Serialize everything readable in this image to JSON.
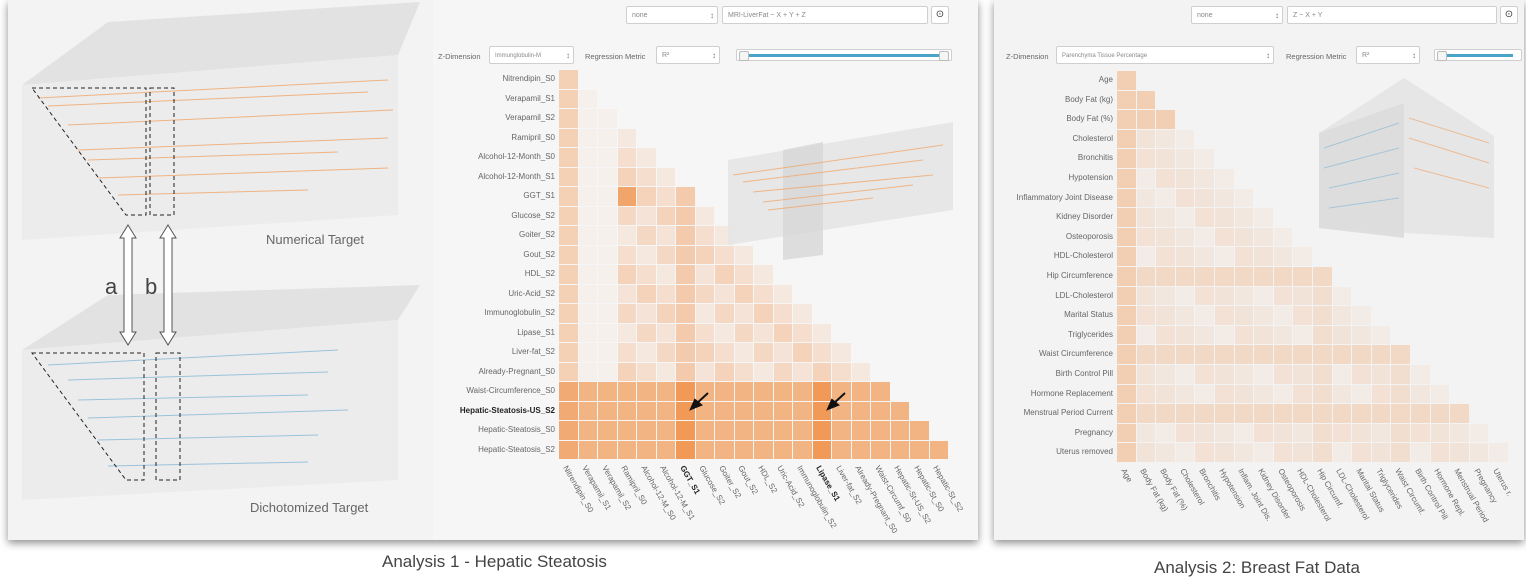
{
  "analysis1": {
    "caption": "Analysis 1 - Hepatic Steatosis",
    "left_labels": {
      "numerical": "Numerical Target",
      "dichotomized": "Dichotomized Target",
      "a": "a",
      "b": "b"
    },
    "top_controls": {
      "select_value": "none",
      "formula_value": "MRI-LiverFat ~ X + Y + Z",
      "target_icon": "target-icon"
    },
    "z_dimension": {
      "label": "Z-Dimension",
      "value": "Immunglobulin-M"
    },
    "regression_metric": {
      "label": "Regression Metric",
      "value": "R²"
    },
    "rows": [
      "Nitrendipin_S0",
      "Verapamil_S1",
      "Verapamil_S2",
      "Ramipril_S0",
      "Alcohol-12-Month_S0",
      "Alcohol-12-Month_S1",
      "GGT_S1",
      "Glucose_S2",
      "Goiter_S2",
      "Gout_S2",
      "HDL_S2",
      "Uric-Acid_S2",
      "Immunoglobulin_S2",
      "Lipase_S1",
      "Liver-fat_S2",
      "Already-Pregnant_S0",
      "Waist-Circumference_S0",
      "Hepatic-Steatosis-US_S2",
      "Hepatic-Steatosis_S0",
      "Hepatic-Steatosis_S2"
    ],
    "bold_row": "Hepatic-Steatosis-US_S2",
    "columns": [
      "Nitrendipin_S0",
      "Verapamil_S1",
      "Verapamil_S2",
      "Ramipril_S0",
      "Alcohol-12-M_S0",
      "Alcohol-12-M_S1",
      "GGT_S1",
      "Glucose_S2",
      "Goiter_S2",
      "Gout_S2",
      "HDL_S2",
      "Uric-Acid_S2",
      "Immunoglobulin_S2",
      "Lipase_S1",
      "Liver-fat_S2",
      "Already-Pregnant_S0",
      "Waist-Circumf_S0",
      "Hepatic-St-US_S2",
      "Hepatic-St_S0",
      "Hepatic-St_S2"
    ],
    "bold_columns": [
      "GGT_S1",
      "Lipase_S1"
    ],
    "matrix_color": "#f08a3c"
  },
  "analysis2": {
    "caption": "Analysis 2: Breast Fat Data",
    "top_controls": {
      "select_value": "none",
      "formula_value": "Z ~ X + Y",
      "target_icon": "target-icon"
    },
    "z_dimension": {
      "label": "Z-Dimension",
      "value": "Parenchyma Tissue Percentage"
    },
    "regression_metric": {
      "label": "Regression Metric",
      "value": "R²"
    },
    "rows": [
      "Age",
      "Body Fat (kg)",
      "Body Fat (%)",
      "Cholesterol",
      "Bronchitis",
      "Hypotension",
      "Inflammatory Joint Disease",
      "Kidney Disorder",
      "Osteoporosis",
      "HDL-Cholesterol",
      "Hip Circumference",
      "LDL-Cholesterol",
      "Marital Status",
      "Triglycerides",
      "Waist Circumference",
      "Birth Control Pill",
      "Hormone Replacement",
      "Menstrual Period Current",
      "Pregnancy",
      "Uterus removed"
    ],
    "columns": [
      "Age",
      "Body Fat (kg)",
      "Body Fat (%)",
      "Cholesterol",
      "Bronchitis",
      "Hypotension",
      "Inflam. Joint Dis.",
      "Kidney Disorder",
      "Osteoporosis",
      "HDL-Cholesterol",
      "Hip Circumf.",
      "LDL-Cholesterol",
      "Marital Status",
      "Triglycerides",
      "Waist Circumf.",
      "Birth Control Pill",
      "Hormone Repl.",
      "Menstrual Period",
      "Pregnancy",
      "Uterus r."
    ],
    "matrix_color": "#f08a3c"
  },
  "colors": {
    "orange": "#f08a3c",
    "blue": "#4aa3c8",
    "panel_bg": "#f3f3f3"
  }
}
